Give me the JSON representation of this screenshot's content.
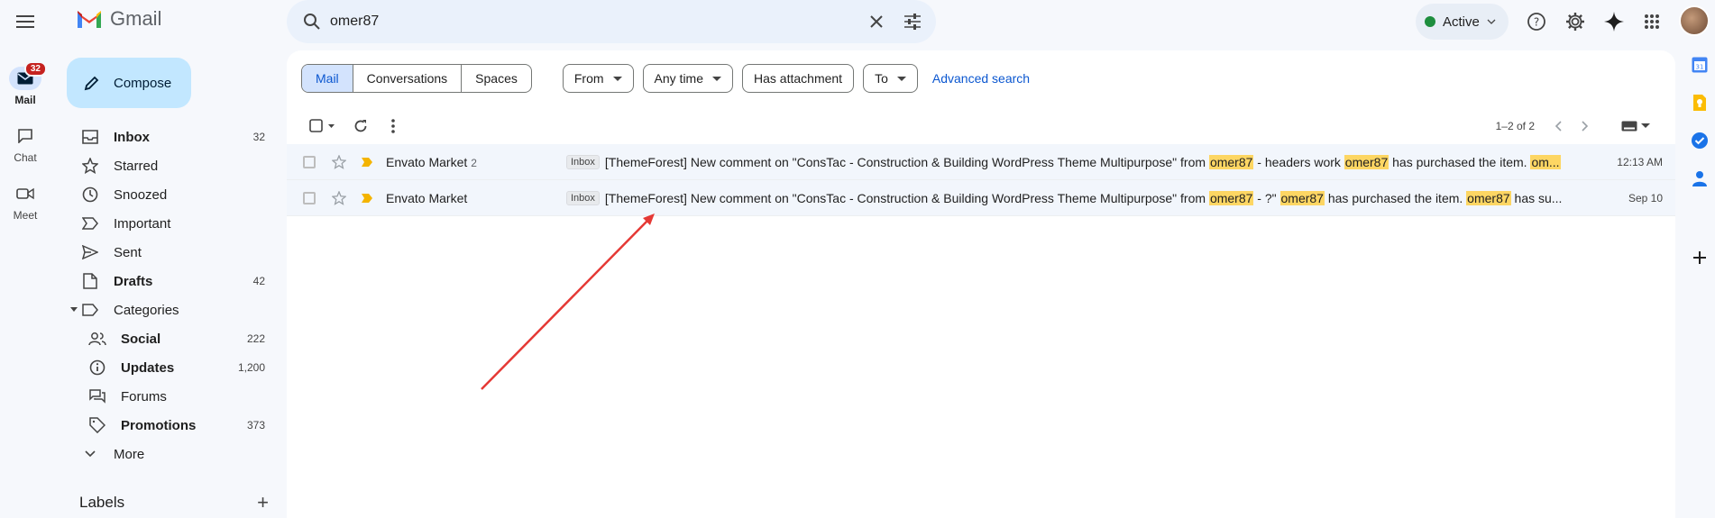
{
  "app": {
    "name": "Gmail"
  },
  "rail": {
    "mail": {
      "label": "Mail",
      "badge": "32"
    },
    "chat": {
      "label": "Chat"
    },
    "meet": {
      "label": "Meet"
    }
  },
  "search": {
    "value": "omer87"
  },
  "status": {
    "label": "Active"
  },
  "compose": {
    "label": "Compose"
  },
  "nav": [
    {
      "label": "Inbox",
      "count": "32",
      "bold": true
    },
    {
      "label": "Starred",
      "count": ""
    },
    {
      "label": "Snoozed",
      "count": ""
    },
    {
      "label": "Important",
      "count": ""
    },
    {
      "label": "Sent",
      "count": ""
    },
    {
      "label": "Drafts",
      "count": "42",
      "bold": true
    },
    {
      "label": "Categories",
      "count": ""
    },
    {
      "label": "Social",
      "count": "222",
      "bold": true
    },
    {
      "label": "Updates",
      "count": "1,200",
      "bold": true
    },
    {
      "label": "Forums",
      "count": ""
    },
    {
      "label": "Promotions",
      "count": "373",
      "bold": true
    },
    {
      "label": "More",
      "count": ""
    }
  ],
  "labels": {
    "title": "Labels"
  },
  "filters": {
    "mail": "Mail",
    "conversations": "Conversations",
    "spaces": "Spaces",
    "from": "From",
    "any_time": "Any time",
    "has_attachment": "Has attachment",
    "to": "To",
    "advanced": "Advanced search"
  },
  "pager": {
    "range": "1–2 of 2"
  },
  "emails": [
    {
      "sender": "Envato Market",
      "thread_count": "2",
      "label": "Inbox",
      "subject_parts": [
        {
          "t": "[ThemeForest] New comment on \"ConsTac - Construction & Building WordPress Theme Multipurpose\" from ",
          "h": false
        },
        {
          "t": "omer87",
          "h": true
        },
        {
          "t": " - headers work ",
          "h": false
        },
        {
          "t": "omer87",
          "h": true
        },
        {
          "t": " has purchased the item. ",
          "h": false
        },
        {
          "t": "om...",
          "h": true
        }
      ],
      "date": "12:13 AM"
    },
    {
      "sender": "Envato Market",
      "thread_count": "",
      "label": "Inbox",
      "subject_parts": [
        {
          "t": "[ThemeForest] New comment on \"ConsTac - Construction & Building WordPress Theme Multipurpose\" from ",
          "h": false
        },
        {
          "t": "omer87",
          "h": true
        },
        {
          "t": " - ?\" ",
          "h": false
        },
        {
          "t": "omer87",
          "h": true
        },
        {
          "t": " has purchased the item. ",
          "h": false
        },
        {
          "t": "omer87",
          "h": true
        },
        {
          "t": " has su...",
          "h": false
        }
      ],
      "date": "Sep 10"
    }
  ],
  "colors": {
    "accent": "#0b57d0",
    "highlight": "#fdd663",
    "annotation_arrow": "#e53935"
  }
}
